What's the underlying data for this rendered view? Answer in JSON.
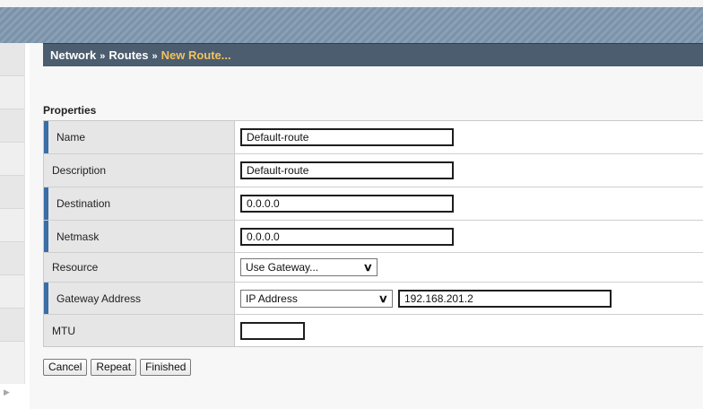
{
  "breadcrumb": {
    "items": [
      "Network",
      "Routes"
    ],
    "separator": "»",
    "current": "New Route..."
  },
  "properties": {
    "title": "Properties",
    "name": {
      "label": "Name",
      "value": "Default-route",
      "required": true
    },
    "description": {
      "label": "Description",
      "value": "Default-route",
      "required": false
    },
    "destination": {
      "label": "Destination",
      "value": "0.0.0.0",
      "required": true
    },
    "netmask": {
      "label": "Netmask",
      "value": "0.0.0.0",
      "required": true
    },
    "resource": {
      "label": "Resource",
      "selected": "Use Gateway...",
      "required": false
    },
    "gateway": {
      "label": "Gateway Address",
      "type_selected": "IP Address",
      "value": "192.168.201.2",
      "required": true
    },
    "mtu": {
      "label": "MTU",
      "value": "",
      "required": false
    }
  },
  "buttons": {
    "cancel": "Cancel",
    "repeat": "Repeat",
    "finished": "Finished"
  },
  "colors": {
    "breadcrumb_bg": "#4b5d6f",
    "breadcrumb_current": "#f2c25c",
    "required_marker": "#3a6ea5"
  },
  "icons": {
    "select_arrow": "chevron-down-icon",
    "sidebar_toggle": "chevron-right-icon"
  }
}
